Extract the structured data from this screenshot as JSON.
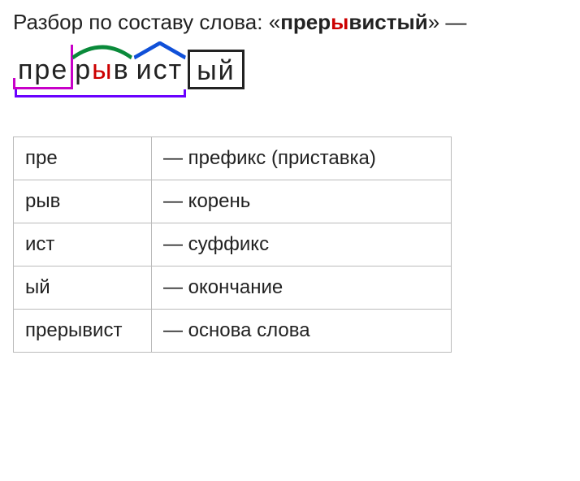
{
  "title": {
    "prefix_text": "Разбор по составу слова: «",
    "word_before_stress": "прер",
    "word_stress": "ы",
    "word_after_stress": "вистый",
    "suffix_text": "» —"
  },
  "morphemes": {
    "prefix": "пре",
    "root_before_stress": "р",
    "root_stress": "ы",
    "root_after_stress": "в",
    "suffix": "ист",
    "ending": "ый"
  },
  "table": {
    "rows": [
      {
        "morph": "пре",
        "desc": "— префикс (приставка)"
      },
      {
        "morph": "рыв",
        "desc": "— корень"
      },
      {
        "morph": "ист",
        "desc": "— суффикс"
      },
      {
        "morph": "ый",
        "desc": "— окончание"
      },
      {
        "morph": "прерывист",
        "desc": "— основа слова"
      }
    ]
  }
}
